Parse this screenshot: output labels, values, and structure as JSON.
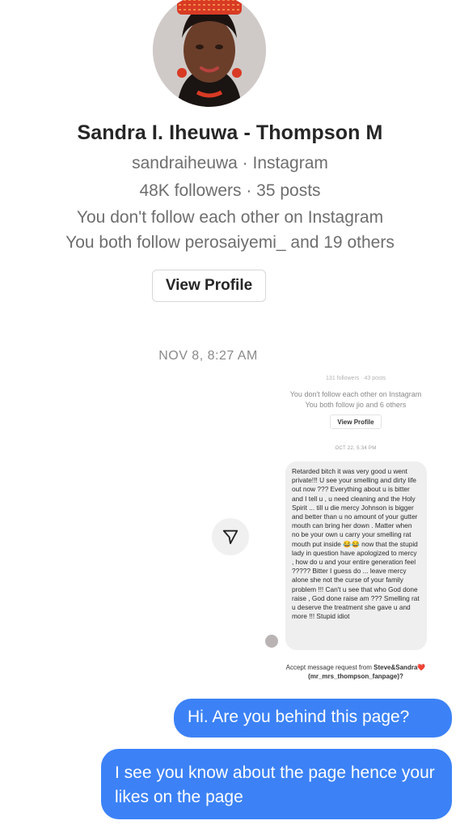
{
  "profile": {
    "name": "Sandra I. Iheuwa - Thompson M",
    "handle_line": "sandraiheuwa · Instagram",
    "stats": "48K followers · 35 posts",
    "follow_status": "You don't follow each other on Instagram",
    "mutuals": "You both follow perosaiyemi_ and 19 others",
    "view_profile_label": "View Profile"
  },
  "thread": {
    "timestamp": "NOV 8, 8:27 AM"
  },
  "shared_screenshot": {
    "faded_top": "131 followers · 43 posts",
    "follow_status": "You don't follow each other on Instagram",
    "mutuals": "You both follow jio and 6 others",
    "view_profile_label": "View Profile",
    "timestamp": "OCT 22, 5:34 PM",
    "message": "Retarded bitch it was very good u went private!!! U see your smelling and dirty life out now ??? Everything about u is bitter and I tell u , u need cleaning and the Holy Spirit ... till u die mercy Johnson is bigger and better than u no amount of your gutter mouth can bring her down . Matter when no be your own u carry your smelling rat mouth put inside 😂😂 now that the stupid lady in question have apologized to mercy , how do u and your entire generation feel ????? Bitter I guess do ... leave mercy alone she not the curse of your family problem !!! Can't u see that who God done raise , God done raise am ??? Smelling rat u deserve the treatment she gave u and more !!! Stupid idiot",
    "accept_prefix": "Accept message request from ",
    "accept_name": "Steve&Sandra❤️",
    "accept_handle": "(mr_mrs_thompson_fanpage)?"
  },
  "messages": [
    {
      "text": "Hi. Are you behind this page?"
    },
    {
      "text": "I see you know about the page hence your likes on the page"
    }
  ],
  "colors": {
    "outgoing_bubble": "#3c82f6",
    "incoming_bubble": "#efefef",
    "secondary_text": "#6e6e6e"
  }
}
